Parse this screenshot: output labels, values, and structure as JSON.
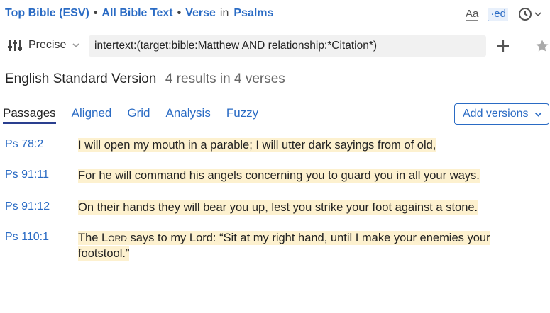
{
  "breadcrumb": {
    "resource": "Top Bible (ESV)",
    "scope": "All Bible Text",
    "unit": "Verse",
    "in_word": "in",
    "book": "Psalms"
  },
  "toolbar": {
    "font_icon": "Aa",
    "ed_icon": "·ed",
    "mode_label": "Precise",
    "query_value": "intertext:(target:bible:Matthew AND relationship:*Citation*)"
  },
  "results_header": {
    "version": "English Standard Version",
    "count": "4 results in 4 verses"
  },
  "tabs": [
    {
      "label": "Passages",
      "active": true
    },
    {
      "label": "Aligned"
    },
    {
      "label": "Grid"
    },
    {
      "label": "Analysis"
    },
    {
      "label": "Fuzzy"
    }
  ],
  "add_versions_label": "Add versions",
  "results": [
    {
      "ref": "Ps 78:2",
      "text": "I will open my mouth in a parable; I will utter dark sayings from of old,"
    },
    {
      "ref": "Ps 91:11",
      "text": "For he will command his angels concerning you to guard you in all your ways."
    },
    {
      "ref": "Ps 91:12",
      "text": "On their hands they will bear you up, lest you strike your foot against a stone."
    },
    {
      "ref": "Ps 110:1",
      "text_pre": "The ",
      "text_lord": "Lord",
      "text_post": " says to my Lord: “Sit at my right hand, until I make your enemies your footstool.”"
    }
  ],
  "colors": {
    "link": "#2a6bc4",
    "highlight": "#fdf1cf",
    "active_tab_underline": "#2a3f8f"
  },
  "icons": {
    "mode": "sliders-icon",
    "dropdown": "chevron-down-icon",
    "add": "plus-icon",
    "favorite": "star-icon",
    "history": "clock-icon"
  }
}
